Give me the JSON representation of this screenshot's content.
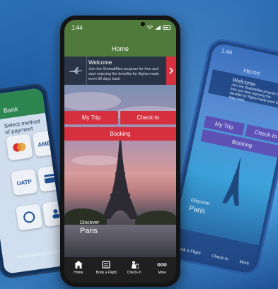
{
  "main": {
    "status_time": "1:44",
    "app_title": "Home",
    "welcome": {
      "title": "Welcome",
      "body": "Join the ShebaMiles program for free and start enjoying the benefits for flights made even 90 days back"
    },
    "buttons": {
      "my_trip": "My Trip",
      "check_in": "Check-In",
      "booking": "Booking"
    },
    "discover": {
      "label": "Discover",
      "city": "Paris"
    },
    "nav": [
      {
        "label": "Home",
        "icon": "home-icon"
      },
      {
        "label": "Book a Flight",
        "icon": "ticket-icon"
      },
      {
        "label": "Check-In",
        "icon": "check-in-icon"
      },
      {
        "label": "More",
        "icon": "more-icon"
      }
    ]
  },
  "right_phone": {
    "status_time": "1:44",
    "app_title": "Home",
    "welcome_title": "Welcome",
    "welcome_body": "Join the ShebaMiles program for free and start enjoying the benefits for flights made even 90 days back",
    "my_trip": "My Trip",
    "check_in": "Check-In",
    "booking": "Booking",
    "discover": "Discover",
    "city": "Paris",
    "nav": [
      "Book a Flight",
      "Check-In",
      "More"
    ]
  },
  "left_phone": {
    "header_title": "Bank",
    "subtitle": "Select method of payment",
    "tile_labels": [
      "AMEX",
      "UATP"
    ]
  },
  "colors": {
    "header_green": "#4f7a3b",
    "accent_red": "#d6303f",
    "banner_dark": "#2a3447",
    "nav_dark": "#1f1f1f"
  }
}
